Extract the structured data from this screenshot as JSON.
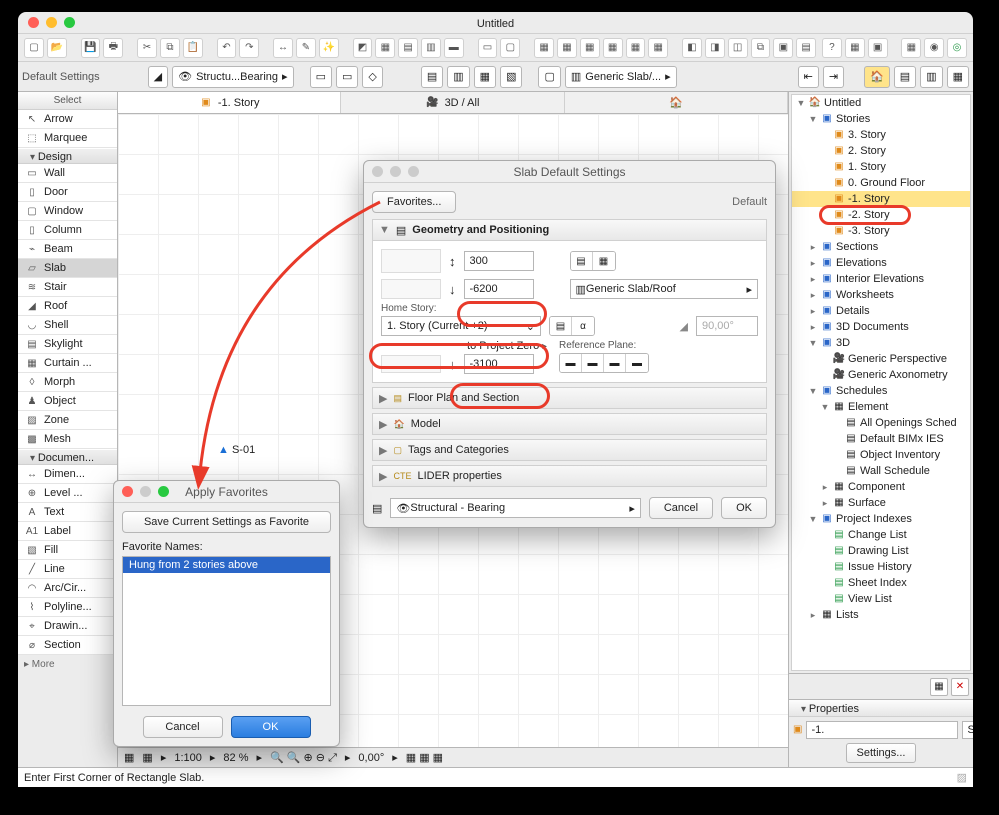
{
  "window": {
    "title": "Untitled"
  },
  "infobar": {
    "mode": "Default Settings",
    "layer_combo": "Structu...Bearing",
    "material_combo": "Generic Slab/..."
  },
  "toolbox": {
    "header": "Select",
    "groups": {
      "select": [
        {
          "icon": "↖",
          "label": "Arrow"
        },
        {
          "icon": "⬚",
          "label": "Marquee"
        }
      ],
      "design_label": "Design",
      "design": [
        {
          "icon": "▭",
          "label": "Wall"
        },
        {
          "icon": "▯",
          "label": "Door"
        },
        {
          "icon": "▢",
          "label": "Window"
        },
        {
          "icon": "▯",
          "label": "Column"
        },
        {
          "icon": "⌁",
          "label": "Beam"
        },
        {
          "icon": "▱",
          "label": "Slab",
          "selected": true
        },
        {
          "icon": "≋",
          "label": "Stair"
        },
        {
          "icon": "◢",
          "label": "Roof"
        },
        {
          "icon": "◡",
          "label": "Shell"
        },
        {
          "icon": "▤",
          "label": "Skylight"
        },
        {
          "icon": "▦",
          "label": "Curtain ..."
        },
        {
          "icon": "◊",
          "label": "Morph"
        },
        {
          "icon": "♟",
          "label": "Object"
        },
        {
          "icon": "▨",
          "label": "Zone"
        },
        {
          "icon": "▩",
          "label": "Mesh"
        }
      ],
      "document_label": "Documen...",
      "document": [
        {
          "icon": "↔",
          "label": "Dimen..."
        },
        {
          "icon": "⊕",
          "label": "Level ..."
        },
        {
          "icon": "A",
          "label": "Text"
        },
        {
          "icon": "A1",
          "label": "Label"
        },
        {
          "icon": "▧",
          "label": "Fill"
        },
        {
          "icon": "╱",
          "label": "Line"
        },
        {
          "icon": "◠",
          "label": "Arc/Cir..."
        },
        {
          "icon": "⌇",
          "label": "Polyline..."
        },
        {
          "icon": "⌖",
          "label": "Drawin..."
        },
        {
          "icon": "⌀",
          "label": "Section"
        }
      ],
      "more": "▸ More"
    }
  },
  "tabs": {
    "story": {
      "icon": "📁",
      "label": "-1. Story"
    },
    "view3d": {
      "icon": "🎥",
      "label": "3D / All"
    }
  },
  "canvas_label": "S-01",
  "statusbar": {
    "scale": "1:100",
    "zoom": "82 %",
    "angle": "0,00°"
  },
  "hint": "Enter First Corner of Rectangle Slab.",
  "navigator_tree": {
    "root": "Untitled",
    "stories_label": "Stories",
    "stories": [
      "3. Story",
      "2. Story",
      "1. Story",
      "0. Ground Floor",
      "-1. Story",
      "-2. Story",
      "-3. Story"
    ],
    "story_selected_index": 4,
    "sections": "Sections",
    "elevations": "Elevations",
    "interior_elev": "Interior Elevations",
    "worksheets": "Worksheets",
    "details": "Details",
    "docs3d": "3D Documents",
    "d3": "3D",
    "d3_items": [
      "Generic Perspective",
      "Generic Axonometry"
    ],
    "schedules": "Schedules",
    "sched_element": "Element",
    "sched_items": [
      "All Openings Sched",
      "Default BIMx IES",
      "Object Inventory",
      "Wall Schedule"
    ],
    "sched_component": "Component",
    "sched_surface": "Surface",
    "proj_index": "Project Indexes",
    "proj_items": [
      "Change List",
      "Drawing List",
      "Issue History",
      "Sheet Index",
      "View List"
    ],
    "lists": "Lists"
  },
  "properties": {
    "header": "Properties",
    "story_num": "-1.",
    "story_name": "Story",
    "settings_btn": "Settings..."
  },
  "slab_dialog": {
    "title": "Slab Default Settings",
    "favorites_btn": "Favorites...",
    "mode_label": "Default",
    "section_geom": "Geometry and Positioning",
    "thickness": "300",
    "offset": "-6200",
    "composite": "Generic Slab/Roof",
    "home_story_label": "Home Story:",
    "home_story": "1. Story (Current +2)",
    "to_zero_label": "to Project Zero",
    "to_zero": "-3100",
    "ref_plane_label": "Reference Plane:",
    "angle": "90,00°",
    "sections_collapsed": [
      "Floor Plan and Section",
      "Model",
      "Tags and Categories",
      "LIDER properties"
    ],
    "layer_combo": "Structural - Bearing",
    "cancel": "Cancel",
    "ok": "OK"
  },
  "fav_dialog": {
    "title": "Apply Favorites",
    "save_btn": "Save Current Settings as Favorite",
    "names_label": "Favorite Names:",
    "items": [
      "Hung from 2 stories above"
    ],
    "cancel": "Cancel",
    "ok": "OK"
  }
}
